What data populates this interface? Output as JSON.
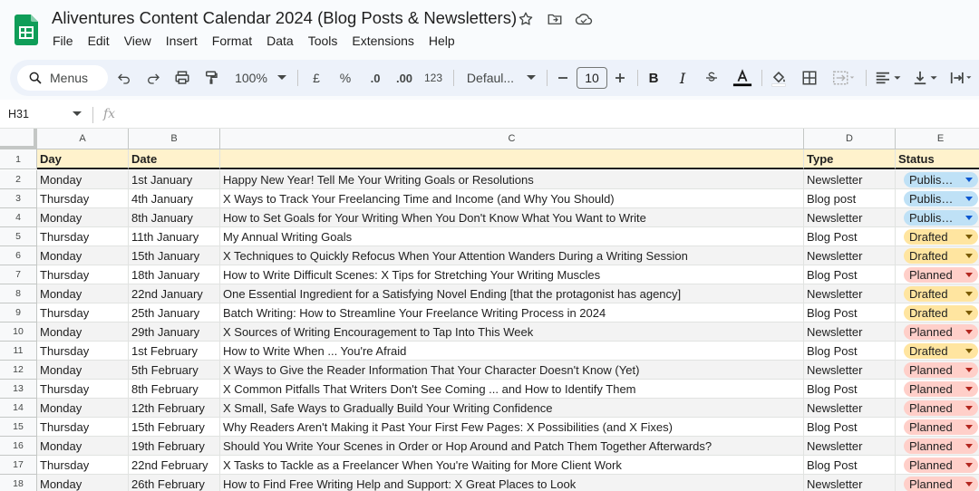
{
  "app": {
    "doc_title": "Aliventures Content Calendar 2024 (Blog Posts & Newsletters)",
    "menu": [
      "File",
      "Edit",
      "View",
      "Insert",
      "Format",
      "Data",
      "Tools",
      "Extensions",
      "Help"
    ]
  },
  "toolbar": {
    "search_label": "Menus",
    "zoom": "100%",
    "currency": "£",
    "percent": "%",
    "dec_decrease": ".0",
    "dec_increase": ".00",
    "number_format": "123",
    "font": "Defaul...",
    "font_size": "10",
    "bold": "B",
    "italic": "I"
  },
  "formula_bar": {
    "cell_ref": "H31",
    "fx_label": "fx"
  },
  "columns": [
    "A",
    "B",
    "C",
    "D",
    "E"
  ],
  "header_row": {
    "num": "1",
    "day": "Day",
    "date": "Date",
    "title": "",
    "type": "Type",
    "status": "Status"
  },
  "rows": [
    {
      "num": "2",
      "day": "Monday",
      "date": "1st January",
      "title": "Happy New Year! Tell Me Your Writing Goals or Resolutions",
      "type": "Newsletter",
      "status": "Publis…",
      "status_kind": "published"
    },
    {
      "num": "3",
      "day": "Thursday",
      "date": "4th January",
      "title": "X Ways to Track Your Freelancing Time and Income (and Why You Should)",
      "type": "Blog post",
      "status": "Publis…",
      "status_kind": "published"
    },
    {
      "num": "4",
      "day": "Monday",
      "date": "8th January",
      "title": "How to Set Goals for Your Writing When You Don't Know What You Want to Write",
      "type": "Newsletter",
      "status": "Publis…",
      "status_kind": "published"
    },
    {
      "num": "5",
      "day": "Thursday",
      "date": "11th January",
      "title": "My Annual Writing Goals",
      "type": "Blog Post",
      "status": "Drafted",
      "status_kind": "drafted"
    },
    {
      "num": "6",
      "day": "Monday",
      "date": "15th January",
      "title": "X Techniques to Quickly Refocus When Your Attention Wanders During a Writing Session",
      "type": "Newsletter",
      "status": "Drafted",
      "status_kind": "drafted"
    },
    {
      "num": "7",
      "day": "Thursday",
      "date": "18th January",
      "title": "How to Write Difficult Scenes: X Tips for Stretching Your Writing Muscles",
      "type": "Blog Post",
      "status": "Planned",
      "status_kind": "planned"
    },
    {
      "num": "8",
      "day": "Monday",
      "date": "22nd January",
      "title": "One Essential Ingredient for a Satisfying Novel Ending [that the protagonist has agency]",
      "type": "Newsletter",
      "status": "Drafted",
      "status_kind": "drafted"
    },
    {
      "num": "9",
      "day": "Thursday",
      "date": "25th January",
      "title": "Batch Writing: How to Streamline Your Freelance Writing Process in 2024",
      "type": "Blog Post",
      "status": "Drafted",
      "status_kind": "drafted"
    },
    {
      "num": "10",
      "day": "Monday",
      "date": "29th January",
      "title": "X Sources of Writing Encouragement to Tap Into This Week",
      "type": "Newsletter",
      "status": "Planned",
      "status_kind": "planned"
    },
    {
      "num": "11",
      "day": "Thursday",
      "date": "1st February",
      "title": "How to Write When ... You're Afraid",
      "type": "Blog Post",
      "status": "Drafted",
      "status_kind": "drafted"
    },
    {
      "num": "12",
      "day": "Monday",
      "date": "5th February",
      "title": "X Ways to Give the Reader Information That Your Character Doesn't Know (Yet)",
      "type": "Newsletter",
      "status": "Planned",
      "status_kind": "planned"
    },
    {
      "num": "13",
      "day": "Thursday",
      "date": "8th February",
      "title": "X Common Pitfalls That Writers Don't See Coming ... and How to Identify Them",
      "type": "Blog Post",
      "status": "Planned",
      "status_kind": "planned"
    },
    {
      "num": "14",
      "day": "Monday",
      "date": "12th February",
      "title": "X Small, Safe Ways to Gradually Build Your Writing Confidence",
      "type": "Newsletter",
      "status": "Planned",
      "status_kind": "planned"
    },
    {
      "num": "15",
      "day": "Thursday",
      "date": "15th February",
      "title": "Why Readers Aren't Making it Past Your First Few Pages: X Possibilities (and X Fixes)",
      "type": "Blog Post",
      "status": "Planned",
      "status_kind": "planned"
    },
    {
      "num": "16",
      "day": "Monday",
      "date": "19th February",
      "title": "Should You Write Your Scenes in Order or Hop Around and Patch Them Together Afterwards?",
      "type": "Newsletter",
      "status": "Planned",
      "status_kind": "planned"
    },
    {
      "num": "17",
      "day": "Thursday",
      "date": "22nd February",
      "title": "X Tasks to Tackle as a Freelancer When You're Waiting for More Client Work",
      "type": "Blog Post",
      "status": "Planned",
      "status_kind": "planned"
    },
    {
      "num": "18",
      "day": "Monday",
      "date": "26th February",
      "title": "How to Find Free Writing Help and Support: X Great Places to Look",
      "type": "Newsletter",
      "status": "Planned",
      "status_kind": "planned"
    }
  ]
}
